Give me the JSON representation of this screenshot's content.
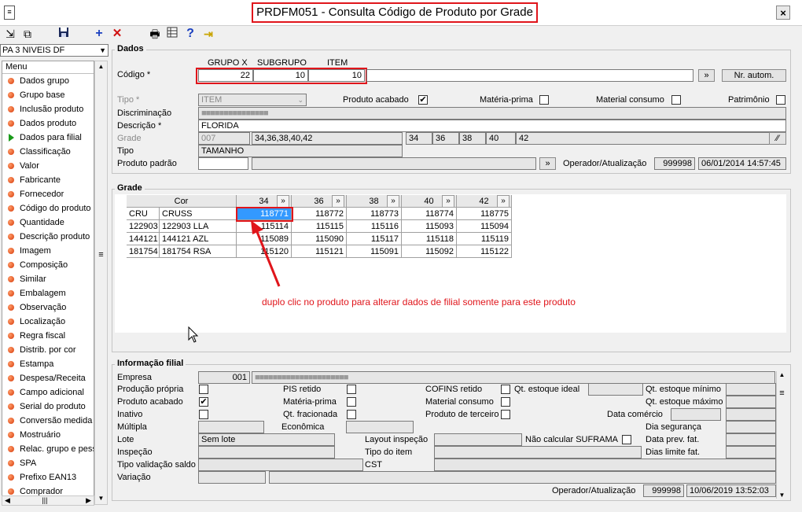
{
  "window": {
    "title": "PRDFM051 - Consulta Código de Produto por Grade",
    "close": "×"
  },
  "toolbar": {
    "icons": [
      "export-icon",
      "copy-icon",
      "save-icon",
      "add-icon",
      "delete-icon",
      "print-icon",
      "table-icon",
      "help-icon",
      "exit-icon"
    ]
  },
  "sidebar": {
    "selector": "PA 3 NIVEIS DF",
    "header": "Menu",
    "items": [
      {
        "label": "Dados grupo"
      },
      {
        "label": "Grupo base"
      },
      {
        "label": "Inclusão produto"
      },
      {
        "label": "Dados produto"
      },
      {
        "label": "Dados para filial",
        "active": true
      },
      {
        "label": "Classificação"
      },
      {
        "label": "Valor"
      },
      {
        "label": "Fabricante"
      },
      {
        "label": "Fornecedor"
      },
      {
        "label": "Código do produto"
      },
      {
        "label": "Quantidade"
      },
      {
        "label": "Descrição produto"
      },
      {
        "label": "Imagem"
      },
      {
        "label": "Composição"
      },
      {
        "label": "Similar"
      },
      {
        "label": "Embalagem"
      },
      {
        "label": "Observação"
      },
      {
        "label": "Localização"
      },
      {
        "label": "Regra fiscal"
      },
      {
        "label": "Distrib. por cor"
      },
      {
        "label": "Estampa"
      },
      {
        "label": "Despesa/Receita"
      },
      {
        "label": "Campo adicional"
      },
      {
        "label": "Serial do produto"
      },
      {
        "label": "Conversão medida"
      },
      {
        "label": "Mostruário"
      },
      {
        "label": "Relac. grupo e pess"
      },
      {
        "label": "SPA"
      },
      {
        "label": "Prefixo EAN13"
      },
      {
        "label": "Comprador"
      }
    ]
  },
  "dados": {
    "title": "Dados",
    "col_headers": [
      "GRUPO X",
      "SUBGRUPO",
      "ITEM"
    ],
    "codigo_label": "Código *",
    "codigo_values": [
      "22",
      "10",
      "10"
    ],
    "btn_next": "»",
    "btn_nr_autom": "Nr. autom.",
    "tipo_label": "Tipo *",
    "tipo_value": "ITEM",
    "produto_acabado_label": "Produto acabado",
    "materia_prima_label": "Matéria-prima",
    "material_consumo_label": "Material consumo",
    "patrimonio_label": "Patrimônio",
    "discriminacao_label": "Discriminação",
    "discriminacao_value": "■■■■■■■■■■■■■■■",
    "descricao_label": "Descrição *",
    "descricao_value": "FLORIDA",
    "grade_label": "Grade",
    "grade_code": "007",
    "grade_sizes_text": "34,36,38,40,42",
    "grade_sizes": [
      "34",
      "36",
      "38",
      "40",
      "42"
    ],
    "tipo2_label": "Tipo",
    "tipo2_value": "TAMANHO",
    "produto_padrao_label": "Produto padrão",
    "operador_label": "Operador/Atualização",
    "operador_value": "999998",
    "operador_date": "06/01/2014 14:57:45"
  },
  "grade": {
    "title": "Grade",
    "cor_header": "Cor",
    "sizes": [
      "34",
      "36",
      "38",
      "40",
      "42"
    ],
    "rows": [
      {
        "code": "CRU",
        "name": "CRUSS",
        "values": [
          "118771",
          "118772",
          "118773",
          "118774",
          "118775"
        ]
      },
      {
        "code": "122903",
        "name": "122903 LLA",
        "values": [
          "115114",
          "115115",
          "115116",
          "115093",
          "115094"
        ]
      },
      {
        "code": "144121",
        "name": "144121 AZL",
        "values": [
          "115089",
          "115090",
          "115117",
          "115118",
          "115119"
        ]
      },
      {
        "code": "181754",
        "name": "181754 RSA",
        "values": [
          "115120",
          "115121",
          "115091",
          "115092",
          "115122"
        ]
      }
    ],
    "annotation": "duplo clic no produto para alterar dados de filial somente para este produto"
  },
  "filial": {
    "title": "Informação filial",
    "empresa_label": "Empresa",
    "empresa_code": "001",
    "empresa_name": "■■■■■■■■■■■■■■■■■■■■■",
    "producao_propria": "Produção própria",
    "pis_retido": "PIS retido",
    "cofins_retido": "COFINS retido",
    "qt_estoque_ideal": "Qt. estoque ideal",
    "qt_estoque_minimo": "Qt. estoque mínimo",
    "produto_acabado": "Produto acabado",
    "materia_prima": "Matéria-prima",
    "material_consumo": "Material consumo",
    "qt_estoque_maximo": "Qt. estoque máximo",
    "inativo": "Inativo",
    "qt_fracionada": "Qt. fracionada",
    "produto_terceiro": "Produto de terceiro",
    "data_comercio": "Data comércio",
    "multipla": "Múltipla",
    "economica": "Econômica",
    "dia_seguranca": "Dia segurança",
    "lote": "Lote",
    "lote_value": "Sem lote",
    "layout_inspecao": "Layout inspeção",
    "nao_calcular_suframa": "Não calcular SUFRAMA",
    "data_prev_fat": "Data prev. fat.",
    "inspecao": "Inspeção",
    "tipo_item": "Tipo do item",
    "dias_limite_fat": "Dias limite fat.",
    "tipo_validacao_saldo": "Tipo validação saldo",
    "cst": "CST",
    "variacao": "Variação",
    "operador_label": "Operador/Atualização",
    "operador_value": "999998",
    "operador_date": "10/06/2019 13:52:03"
  }
}
